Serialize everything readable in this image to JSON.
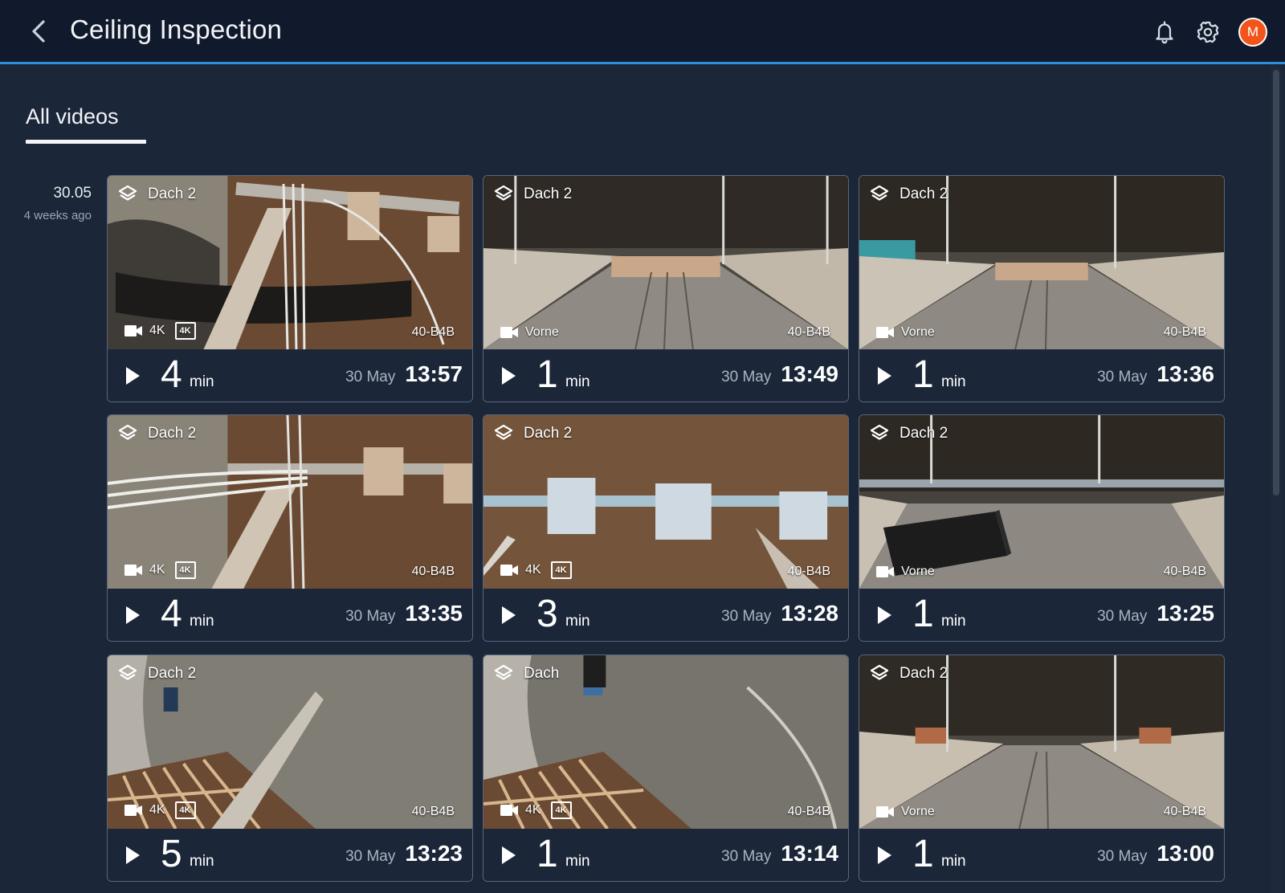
{
  "header": {
    "title": "Ceiling Inspection",
    "back_icon": "chevron-left-icon",
    "notification_icon": "bell-icon",
    "settings_icon": "gear-icon",
    "avatar_initial": "M",
    "accent_color": "#2d8fd5",
    "avatar_color": "#f2541b"
  },
  "tabs": [
    {
      "label": "All videos",
      "active": true
    }
  ],
  "group": {
    "date": "30.05",
    "relative": "4 weeks ago"
  },
  "videos": [
    {
      "location": "Dach 2",
      "camera": "4K",
      "badge": "4K",
      "code": "40-B4B",
      "duration": "4",
      "unit": "min",
      "day": "30 May",
      "time": "13:57"
    },
    {
      "location": "Dach 2",
      "camera": "Vorne",
      "badge": "",
      "code": "40-B4B",
      "duration": "1",
      "unit": "min",
      "day": "30 May",
      "time": "13:49"
    },
    {
      "location": "Dach 2",
      "camera": "Vorne",
      "badge": "",
      "code": "40-B4B",
      "duration": "1",
      "unit": "min",
      "day": "30 May",
      "time": "13:36"
    },
    {
      "location": "Dach 2",
      "camera": "4K",
      "badge": "4K",
      "code": "40-B4B",
      "duration": "4",
      "unit": "min",
      "day": "30 May",
      "time": "13:35"
    },
    {
      "location": "Dach 2",
      "camera": "4K",
      "badge": "4K",
      "code": "40-B4B",
      "duration": "3",
      "unit": "min",
      "day": "30 May",
      "time": "13:28"
    },
    {
      "location": "Dach 2",
      "camera": "Vorne",
      "badge": "",
      "code": "40-B4B",
      "duration": "1",
      "unit": "min",
      "day": "30 May",
      "time": "13:25"
    },
    {
      "location": "Dach 2",
      "camera": "4K",
      "badge": "4K",
      "code": "40-B4B",
      "duration": "5",
      "unit": "min",
      "day": "30 May",
      "time": "13:23"
    },
    {
      "location": "Dach",
      "camera": "4K",
      "badge": "4K",
      "code": "40-B4B",
      "duration": "1",
      "unit": "min",
      "day": "30 May",
      "time": "13:14"
    },
    {
      "location": "Dach 2",
      "camera": "Vorne",
      "badge": "",
      "code": "40-B4B",
      "duration": "1",
      "unit": "min",
      "day": "30 May",
      "time": "13:00"
    }
  ]
}
